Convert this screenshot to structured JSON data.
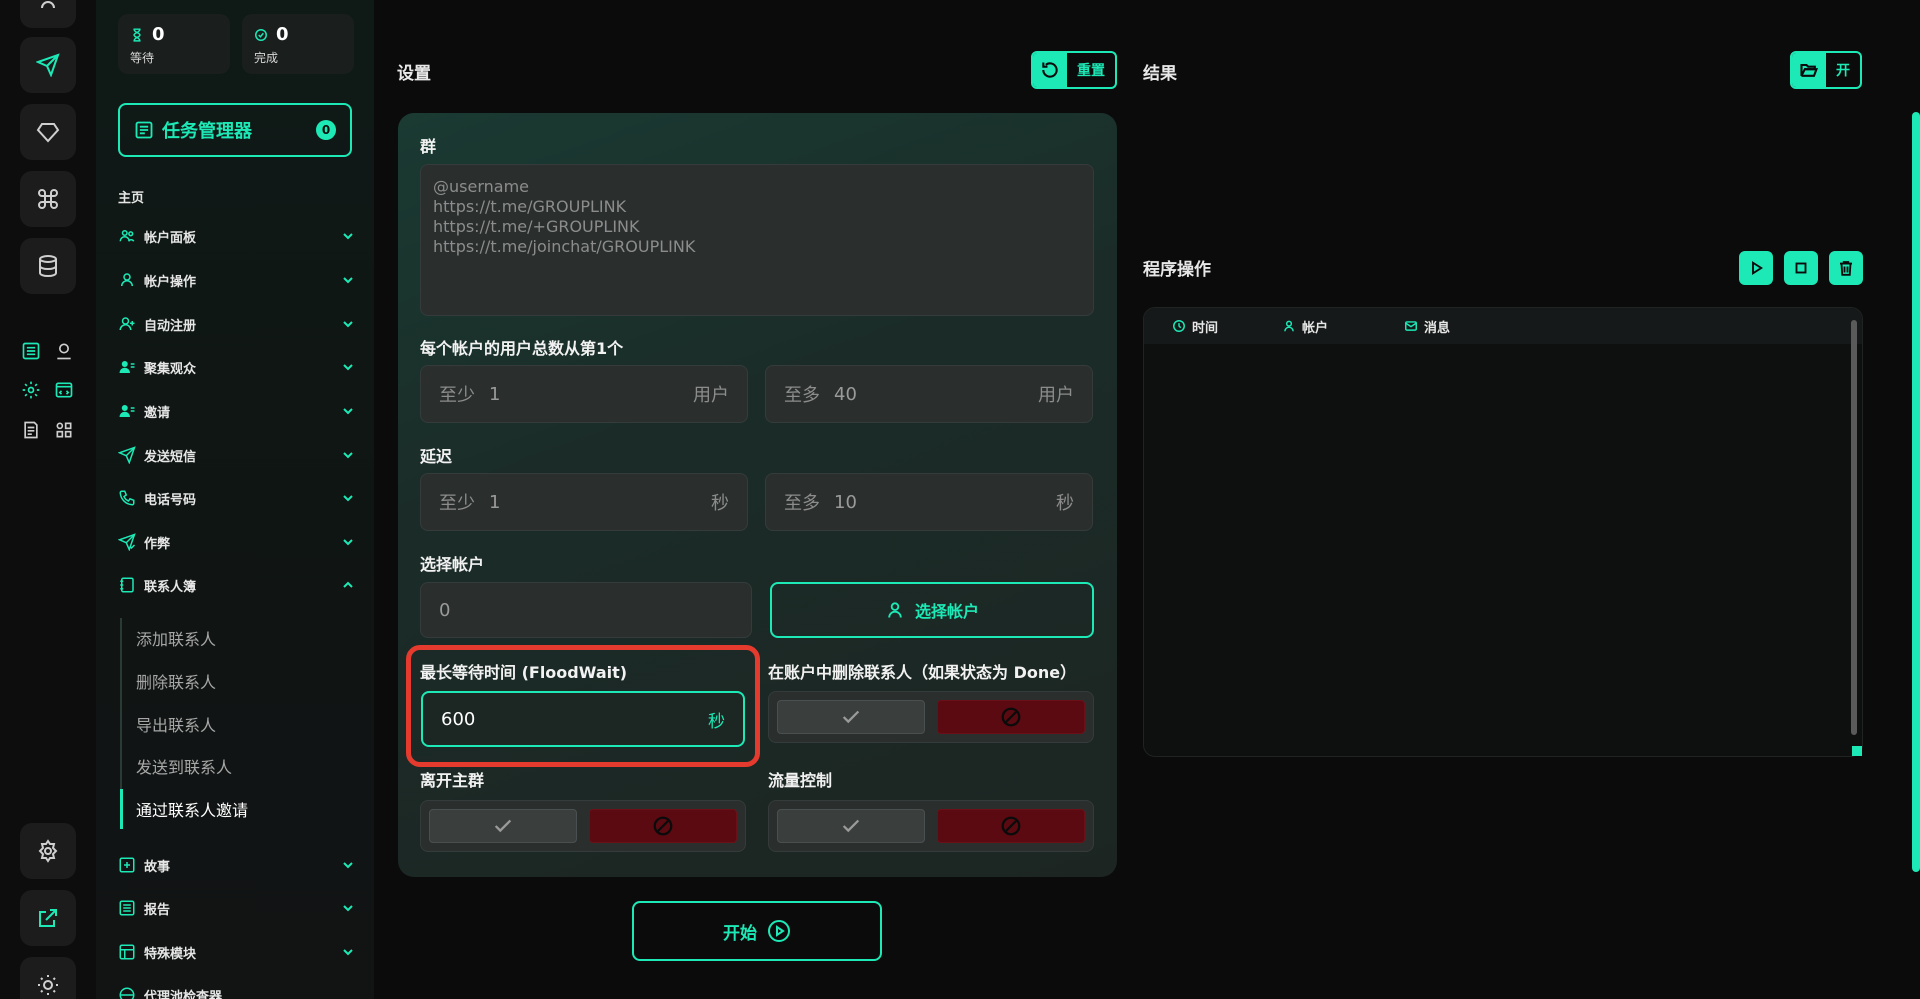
{
  "stats": {
    "waiting": {
      "count": "0",
      "label": "等待"
    },
    "done": {
      "count": "0",
      "label": "完成"
    }
  },
  "task_manager": {
    "label": "任务管理器",
    "badge": "0"
  },
  "sidebar": {
    "section_title": "主页",
    "items": [
      {
        "label": "帐户面板"
      },
      {
        "label": "帐户操作"
      },
      {
        "label": "自动注册"
      },
      {
        "label": "聚集观众"
      },
      {
        "label": "邀请"
      },
      {
        "label": "发送短信"
      },
      {
        "label": "电话号码"
      },
      {
        "label": "作弊"
      },
      {
        "label": "联系人簿"
      },
      {
        "label": "故事"
      },
      {
        "label": "报告"
      },
      {
        "label": "特殊模块"
      },
      {
        "label": "代理池检查器"
      }
    ],
    "subitems": [
      {
        "label": "添加联系人"
      },
      {
        "label": "删除联系人"
      },
      {
        "label": "导出联系人"
      },
      {
        "label": "发送到联系人"
      },
      {
        "label": "通过联系人邀请"
      }
    ]
  },
  "settings": {
    "title": "设置",
    "reset_label": "重置",
    "group_label": "群",
    "group_placeholder_lines": [
      "@username",
      "https://t.me/GROUPLINK",
      "https://t.me/+GROUPLINK",
      "https://t.me/joinchat/GROUPLINK"
    ],
    "users_label": "每个帐户的用户总数从第1个",
    "users_min": {
      "prefix": "至少",
      "value": "1",
      "suffix": "用户"
    },
    "users_max": {
      "prefix": "至多",
      "value": "40",
      "suffix": "用户"
    },
    "delay_label": "延迟",
    "delay_min": {
      "prefix": "至少",
      "value": "1",
      "suffix": "秒"
    },
    "delay_max": {
      "prefix": "至多",
      "value": "10",
      "suffix": "秒"
    },
    "select_accounts_label": "选择帐户",
    "accounts_count": "0",
    "select_accounts_button": "选择帐户",
    "floodwait_label": "最长等待时间 (FloodWait)",
    "floodwait_value": "600",
    "floodwait_suffix": "秒",
    "delete_contacts_label": "在账户中删除联系人（如果状态为 Done）",
    "leave_group_label": "离开主群",
    "traffic_control_label": "流量控制",
    "start_label": "开始"
  },
  "results": {
    "title": "结果",
    "open_label": "开",
    "program_ops_title": "程序操作",
    "columns": [
      "时间",
      "帐户",
      "消息"
    ]
  },
  "colors": {
    "accent": "#1de9b6",
    "danger": "#5a0a10",
    "highlight": "#e53a2e"
  }
}
